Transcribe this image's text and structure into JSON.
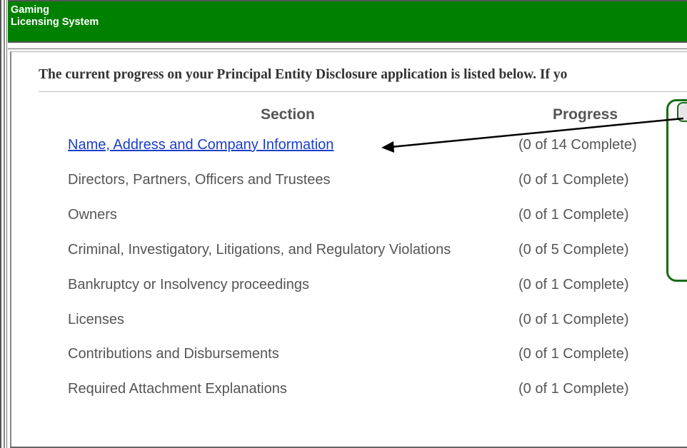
{
  "header": {
    "title_line1": "Gaming",
    "title_line2": "Licensing System"
  },
  "intro_text": "The current progress on your Principal Entity Disclosure application is listed below. If yo",
  "table": {
    "col_section": "Section",
    "col_progress": "Progress",
    "rows": [
      {
        "section": "Name, Address and Company Information",
        "progress": "(0 of 14 Complete)"
      },
      {
        "section": "Directors, Partners, Officers and Trustees",
        "progress": "(0 of 1 Complete)"
      },
      {
        "section": "Owners",
        "progress": "(0 of 1 Complete)"
      },
      {
        "section": "Criminal, Investigatory, Litigations, and Regulatory Violations",
        "progress": "(0 of 5 Complete)"
      },
      {
        "section": "Bankruptcy or Insolvency proceedings",
        "progress": "(0 of 1 Complete)"
      },
      {
        "section": "Licenses",
        "progress": "(0 of 1 Complete)"
      },
      {
        "section": "Contributions and Disbursements",
        "progress": "(0 of 1 Complete)"
      },
      {
        "section": "Required Attachment Explanations",
        "progress": "(0 of 1 Complete)"
      }
    ]
  },
  "colors": {
    "header_bg": "#008000",
    "link": "#1a3ec8",
    "callout_border": "#156d15"
  }
}
